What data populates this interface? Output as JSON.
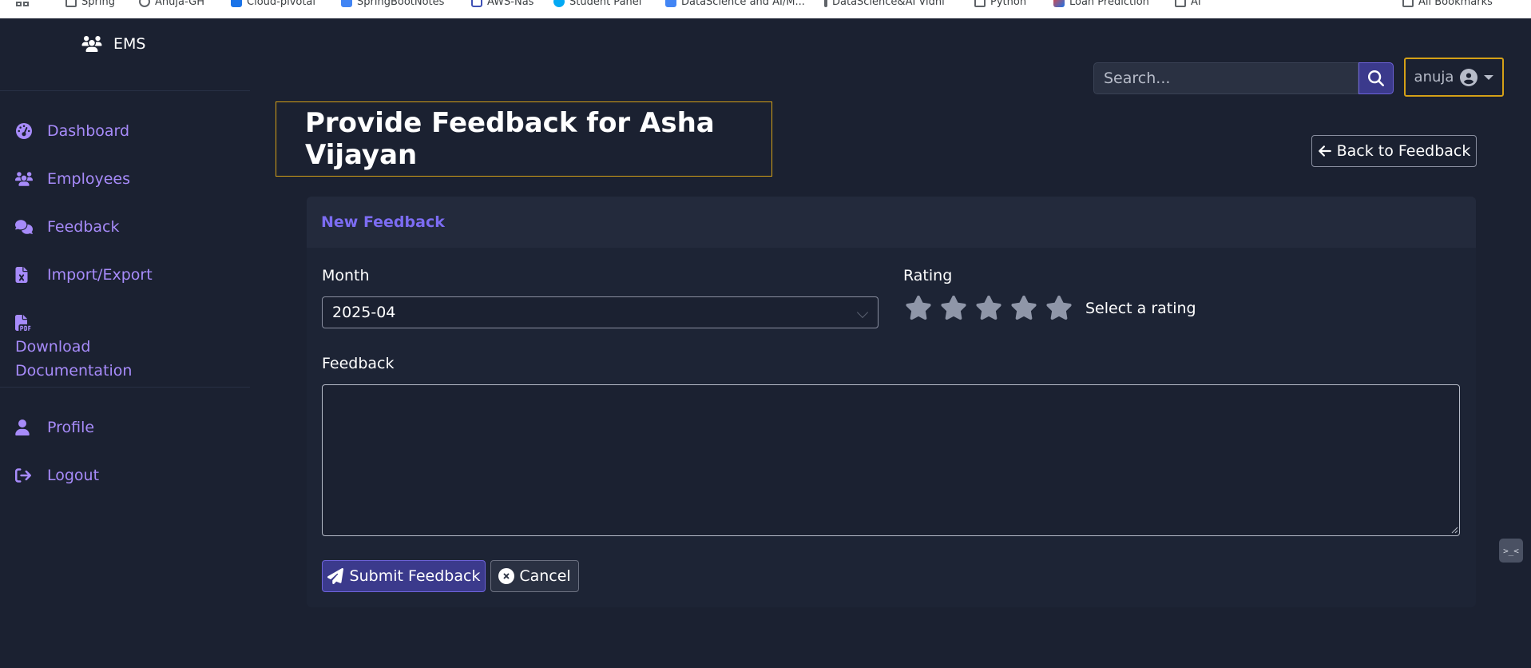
{
  "bookmarks": {
    "items": [
      {
        "label": "Spring",
        "icon": "folder-icon"
      },
      {
        "label": "Anuja-GH",
        "icon": "github-icon"
      },
      {
        "label": "Cloud-pivotal",
        "icon": "bookmark-icon"
      },
      {
        "label": "SpringBootNotes",
        "icon": "doc-icon"
      },
      {
        "label": "AWS-Nas",
        "icon": "doc-icon"
      },
      {
        "label": "Student Panel",
        "icon": "globe-icon"
      },
      {
        "label": "DataScience and AI/M...",
        "icon": "doc-icon"
      },
      {
        "label": "DataScience&AI Vidhi",
        "icon": "bookmark-icon"
      },
      {
        "label": "Python",
        "icon": "folder-icon"
      },
      {
        "label": "Loan Prediction",
        "icon": "chart-icon"
      },
      {
        "label": "AI",
        "icon": "folder-icon"
      }
    ],
    "all_bookmarks": "All Bookmarks"
  },
  "sidebar": {
    "brand": "EMS",
    "items": [
      {
        "label": "Dashboard",
        "icon": "dashboard-icon"
      },
      {
        "label": "Employees",
        "icon": "users-icon"
      },
      {
        "label": "Feedback",
        "icon": "comments-icon"
      },
      {
        "label": "Import/Export",
        "icon": "excel-file-icon"
      },
      {
        "label": "Download Documentation",
        "icon": "pdf-file-icon"
      },
      {
        "label": "Profile",
        "icon": "user-icon"
      },
      {
        "label": "Logout",
        "icon": "logout-icon"
      }
    ]
  },
  "topbar": {
    "search_placeholder": "Search...",
    "user_name": "anuja"
  },
  "page": {
    "title": "Provide Feedback for Asha Vijayan",
    "back_label": "Back to Feedback"
  },
  "form": {
    "card_title": "New Feedback",
    "month_label": "Month",
    "month_value": "2025-04",
    "rating_label": "Rating",
    "rating_value": 0,
    "rating_max": 5,
    "rating_hint": "Select a rating",
    "feedback_label": "Feedback",
    "feedback_value": "",
    "submit_label": "Submit Feedback",
    "cancel_label": "Cancel"
  },
  "colors": {
    "background": "#1b2131",
    "accent": "#a78bfa",
    "highlight_border": "#d4a017",
    "primary_button": "#3b3a8c",
    "star_inactive": "#8f96a8"
  }
}
